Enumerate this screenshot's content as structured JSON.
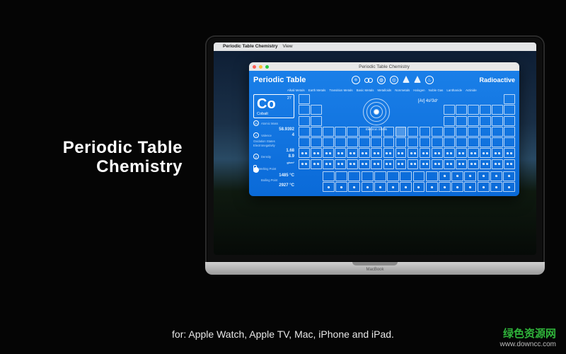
{
  "promo": {
    "title_line1": "Periodic Table",
    "title_line2": "Chemistry"
  },
  "menubar": {
    "app": "Periodic Table Chemistry",
    "view": "View"
  },
  "window": {
    "title": "Periodic Table Chemistry",
    "app_title": "Periodic Table",
    "radio_label": "Radioactive",
    "categories": [
      "Alkali Metals",
      "Earth Metals",
      "Transition Metals",
      "Basic Metals",
      "Metalloids",
      "Nonmetals",
      "Halogen",
      "Noble Gas",
      "Lanthanide",
      "Actinide"
    ],
    "electron_config_html": "[Ar] 4s²3d⁷",
    "shell_label": "Electron Shells",
    "selected": {
      "number": "27",
      "symbol": "Co",
      "name": "Cobalt"
    },
    "props": {
      "atomic_mass_label": "Atomic Mass",
      "atomic_mass": "58.9392",
      "valence_label": "Valence",
      "valence": "4",
      "oxidation_label": "Oxidation States",
      "electronegativity_label": "Electronegativity",
      "electronegativity": "1.68",
      "density_label": "Density",
      "density": "8.9",
      "density_unit": "g/cm³",
      "melting_label": "Melting Point",
      "melting": "1485 °C",
      "boiling_label": "Boiling Point",
      "boiling": "2927 °C"
    }
  },
  "subtitle": "for: Apple Watch, Apple TV, Mac, iPhone and iPad.",
  "laptop_brand": "MacBook",
  "watermark": {
    "cn": "绿色资源网",
    "url": "www.downcc.com"
  },
  "colors": {
    "app_blue": "#1a7fe8"
  }
}
